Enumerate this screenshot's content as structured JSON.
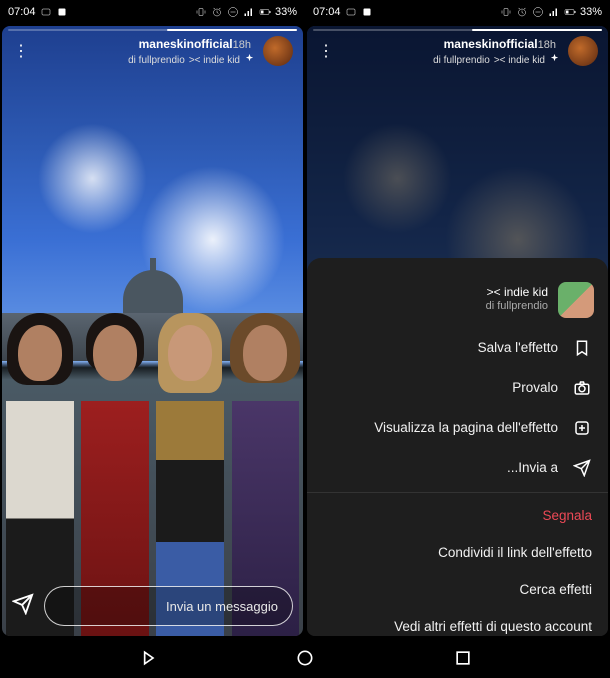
{
  "status": {
    "time": "07:04",
    "battery": "33%"
  },
  "story": {
    "username": "maneskinofficial",
    "time_ago": "18h",
    "effect_prefix": "indie kid >< ",
    "effect_author": "di fullprendio"
  },
  "footer": {
    "placeholder": "Invia un messaggio"
  },
  "sheet": {
    "effect_name": "indie kid ><",
    "effect_by": "di fullprendio",
    "save": "Salva l'effetto",
    "try": "Provalo",
    "view_page": "Visualizza la pagina dell'effetto",
    "send_to": "Invia a...",
    "report": "Segnala",
    "share_link": "Condividi il link dell'effetto",
    "browse": "Cerca effetti",
    "more_from": "Vedi altri effetti di questo account"
  }
}
